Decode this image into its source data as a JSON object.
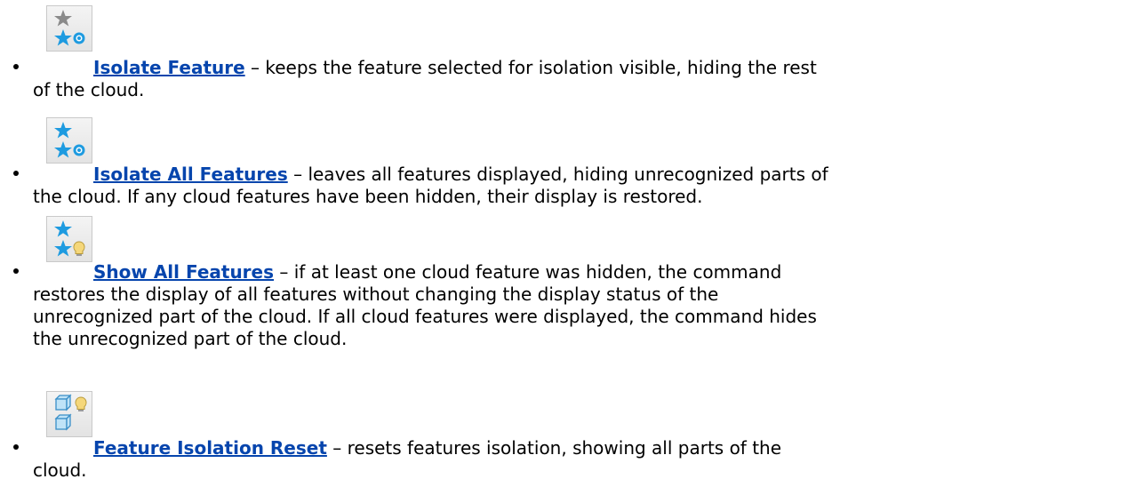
{
  "items": [
    {
      "icon": "isolate-feature-icon",
      "link": "Isolate Feature",
      "line1": " – keeps the feature selected for isolation visible, hiding the rest",
      "line2": "of the cloud.",
      "line3": ""
    },
    {
      "icon": "isolate-all-features-icon",
      "link": "Isolate All Features",
      "line1": " – leaves all features displayed, hiding unrecognized parts of",
      "line2": "the cloud. If any cloud features have been hidden, their display is restored.",
      "line3": ""
    },
    {
      "icon": "show-all-features-icon",
      "link": "Show All Features",
      "line1": " – if at least one cloud feature was hidden, the command",
      "line2": "restores the display of all features without changing the display status of the",
      "line3": "unrecognized part of the cloud. If all cloud features were displayed, the command hides",
      "line4": "the unrecognized part of the cloud."
    },
    {
      "icon": "feature-isolation-reset-icon",
      "link": "Feature Isolation Reset",
      "line1": " – resets features isolation, showing all parts of the",
      "line2": "cloud.",
      "line3": ""
    }
  ],
  "colors": {
    "link": "#0645ad",
    "star_blue": "#1e9be0",
    "star_gray": "#8a8a8a",
    "bulb": "#f5d77a"
  }
}
